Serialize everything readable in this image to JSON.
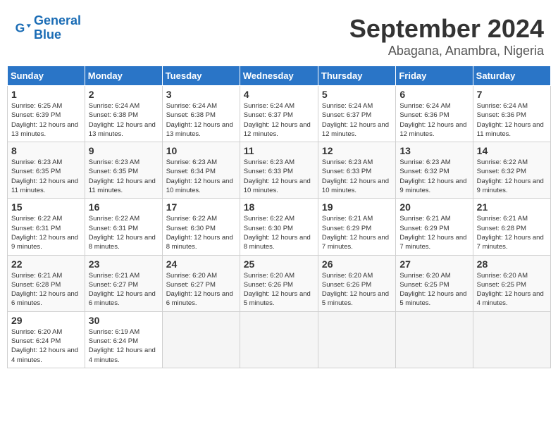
{
  "logo": {
    "text_general": "General",
    "text_blue": "Blue"
  },
  "title": {
    "month": "September 2024",
    "location": "Abagana, Anambra, Nigeria"
  },
  "headers": [
    "Sunday",
    "Monday",
    "Tuesday",
    "Wednesday",
    "Thursday",
    "Friday",
    "Saturday"
  ],
  "weeks": [
    [
      {
        "day": "1",
        "sunrise": "Sunrise: 6:25 AM",
        "sunset": "Sunset: 6:39 PM",
        "daylight": "Daylight: 12 hours and 13 minutes."
      },
      {
        "day": "2",
        "sunrise": "Sunrise: 6:24 AM",
        "sunset": "Sunset: 6:38 PM",
        "daylight": "Daylight: 12 hours and 13 minutes."
      },
      {
        "day": "3",
        "sunrise": "Sunrise: 6:24 AM",
        "sunset": "Sunset: 6:38 PM",
        "daylight": "Daylight: 12 hours and 13 minutes."
      },
      {
        "day": "4",
        "sunrise": "Sunrise: 6:24 AM",
        "sunset": "Sunset: 6:37 PM",
        "daylight": "Daylight: 12 hours and 12 minutes."
      },
      {
        "day": "5",
        "sunrise": "Sunrise: 6:24 AM",
        "sunset": "Sunset: 6:37 PM",
        "daylight": "Daylight: 12 hours and 12 minutes."
      },
      {
        "day": "6",
        "sunrise": "Sunrise: 6:24 AM",
        "sunset": "Sunset: 6:36 PM",
        "daylight": "Daylight: 12 hours and 12 minutes."
      },
      {
        "day": "7",
        "sunrise": "Sunrise: 6:24 AM",
        "sunset": "Sunset: 6:36 PM",
        "daylight": "Daylight: 12 hours and 11 minutes."
      }
    ],
    [
      {
        "day": "8",
        "sunrise": "Sunrise: 6:23 AM",
        "sunset": "Sunset: 6:35 PM",
        "daylight": "Daylight: 12 hours and 11 minutes."
      },
      {
        "day": "9",
        "sunrise": "Sunrise: 6:23 AM",
        "sunset": "Sunset: 6:35 PM",
        "daylight": "Daylight: 12 hours and 11 minutes."
      },
      {
        "day": "10",
        "sunrise": "Sunrise: 6:23 AM",
        "sunset": "Sunset: 6:34 PM",
        "daylight": "Daylight: 12 hours and 10 minutes."
      },
      {
        "day": "11",
        "sunrise": "Sunrise: 6:23 AM",
        "sunset": "Sunset: 6:33 PM",
        "daylight": "Daylight: 12 hours and 10 minutes."
      },
      {
        "day": "12",
        "sunrise": "Sunrise: 6:23 AM",
        "sunset": "Sunset: 6:33 PM",
        "daylight": "Daylight: 12 hours and 10 minutes."
      },
      {
        "day": "13",
        "sunrise": "Sunrise: 6:23 AM",
        "sunset": "Sunset: 6:32 PM",
        "daylight": "Daylight: 12 hours and 9 minutes."
      },
      {
        "day": "14",
        "sunrise": "Sunrise: 6:22 AM",
        "sunset": "Sunset: 6:32 PM",
        "daylight": "Daylight: 12 hours and 9 minutes."
      }
    ],
    [
      {
        "day": "15",
        "sunrise": "Sunrise: 6:22 AM",
        "sunset": "Sunset: 6:31 PM",
        "daylight": "Daylight: 12 hours and 9 minutes."
      },
      {
        "day": "16",
        "sunrise": "Sunrise: 6:22 AM",
        "sunset": "Sunset: 6:31 PM",
        "daylight": "Daylight: 12 hours and 8 minutes."
      },
      {
        "day": "17",
        "sunrise": "Sunrise: 6:22 AM",
        "sunset": "Sunset: 6:30 PM",
        "daylight": "Daylight: 12 hours and 8 minutes."
      },
      {
        "day": "18",
        "sunrise": "Sunrise: 6:22 AM",
        "sunset": "Sunset: 6:30 PM",
        "daylight": "Daylight: 12 hours and 8 minutes."
      },
      {
        "day": "19",
        "sunrise": "Sunrise: 6:21 AM",
        "sunset": "Sunset: 6:29 PM",
        "daylight": "Daylight: 12 hours and 7 minutes."
      },
      {
        "day": "20",
        "sunrise": "Sunrise: 6:21 AM",
        "sunset": "Sunset: 6:29 PM",
        "daylight": "Daylight: 12 hours and 7 minutes."
      },
      {
        "day": "21",
        "sunrise": "Sunrise: 6:21 AM",
        "sunset": "Sunset: 6:28 PM",
        "daylight": "Daylight: 12 hours and 7 minutes."
      }
    ],
    [
      {
        "day": "22",
        "sunrise": "Sunrise: 6:21 AM",
        "sunset": "Sunset: 6:28 PM",
        "daylight": "Daylight: 12 hours and 6 minutes."
      },
      {
        "day": "23",
        "sunrise": "Sunrise: 6:21 AM",
        "sunset": "Sunset: 6:27 PM",
        "daylight": "Daylight: 12 hours and 6 minutes."
      },
      {
        "day": "24",
        "sunrise": "Sunrise: 6:20 AM",
        "sunset": "Sunset: 6:27 PM",
        "daylight": "Daylight: 12 hours and 6 minutes."
      },
      {
        "day": "25",
        "sunrise": "Sunrise: 6:20 AM",
        "sunset": "Sunset: 6:26 PM",
        "daylight": "Daylight: 12 hours and 5 minutes."
      },
      {
        "day": "26",
        "sunrise": "Sunrise: 6:20 AM",
        "sunset": "Sunset: 6:26 PM",
        "daylight": "Daylight: 12 hours and 5 minutes."
      },
      {
        "day": "27",
        "sunrise": "Sunrise: 6:20 AM",
        "sunset": "Sunset: 6:25 PM",
        "daylight": "Daylight: 12 hours and 5 minutes."
      },
      {
        "day": "28",
        "sunrise": "Sunrise: 6:20 AM",
        "sunset": "Sunset: 6:25 PM",
        "daylight": "Daylight: 12 hours and 4 minutes."
      }
    ],
    [
      {
        "day": "29",
        "sunrise": "Sunrise: 6:20 AM",
        "sunset": "Sunset: 6:24 PM",
        "daylight": "Daylight: 12 hours and 4 minutes."
      },
      {
        "day": "30",
        "sunrise": "Sunrise: 6:19 AM",
        "sunset": "Sunset: 6:24 PM",
        "daylight": "Daylight: 12 hours and 4 minutes."
      },
      null,
      null,
      null,
      null,
      null
    ]
  ]
}
